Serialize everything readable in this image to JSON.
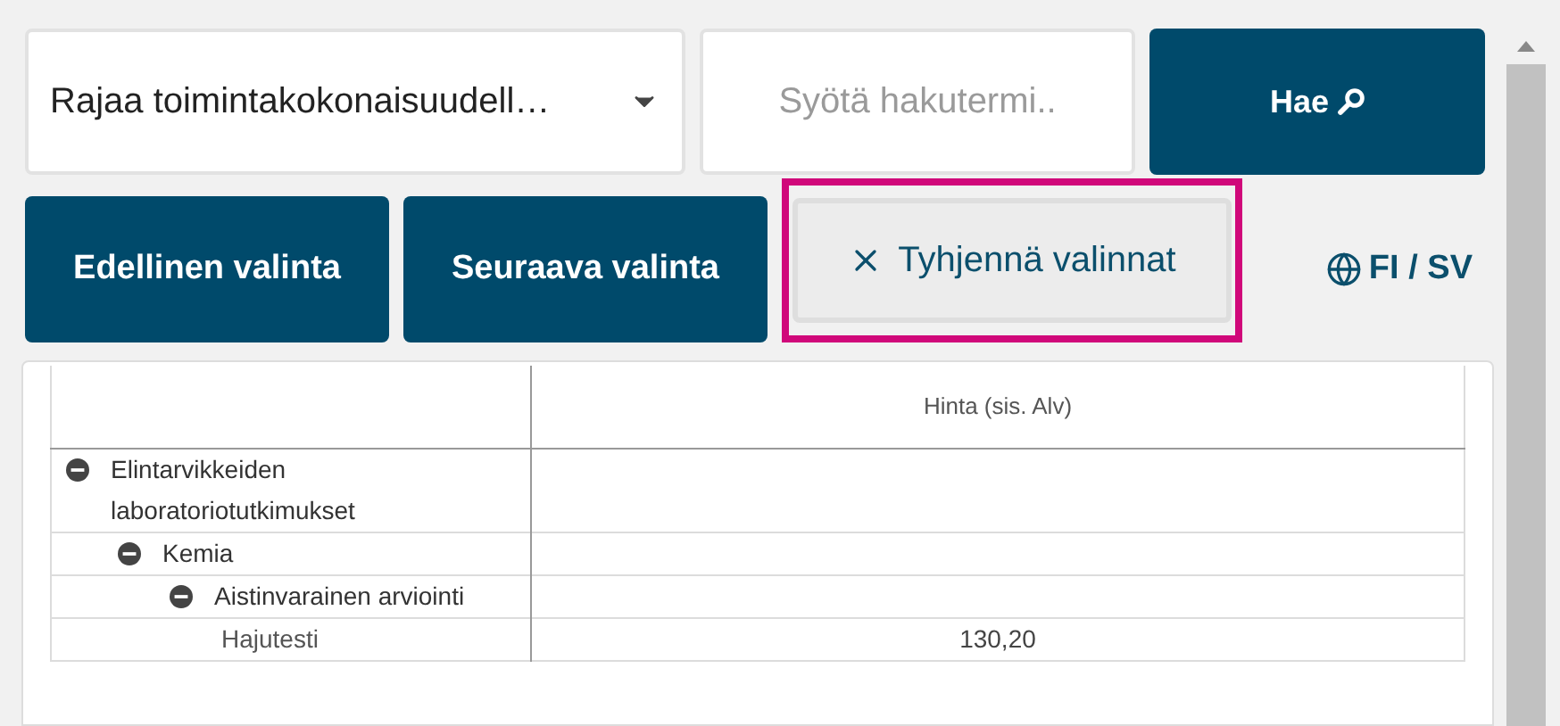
{
  "filter_select": {
    "value": "Rajaa toimintakokonaisuudell…"
  },
  "search": {
    "placeholder": "Syötä hakutermi.."
  },
  "search_button": "Hae",
  "buttons": [
    {
      "label": "Edellinen valinta",
      "kind": "primary",
      "highlighted": false
    },
    {
      "label": "Seuraava valinta",
      "kind": "primary",
      "highlighted": false
    },
    {
      "label": "Tyhjennä valinnat",
      "kind": "clear",
      "highlighted": true
    }
  ],
  "language": "FI / SV",
  "table": {
    "price_header": "Hinta (sis. Alv)",
    "rows": [
      {
        "label": "Elintarvikkeiden laboratoriotutkimukset",
        "expanded": true,
        "children": [
          {
            "label": "Kemia",
            "expanded": true,
            "children": [
              {
                "label": "Aistinvarainen arviointi",
                "expanded": true,
                "children": [
                  {
                    "label": "Hajutesti",
                    "price": "130,20"
                  }
                ]
              }
            ]
          }
        ]
      }
    ]
  }
}
